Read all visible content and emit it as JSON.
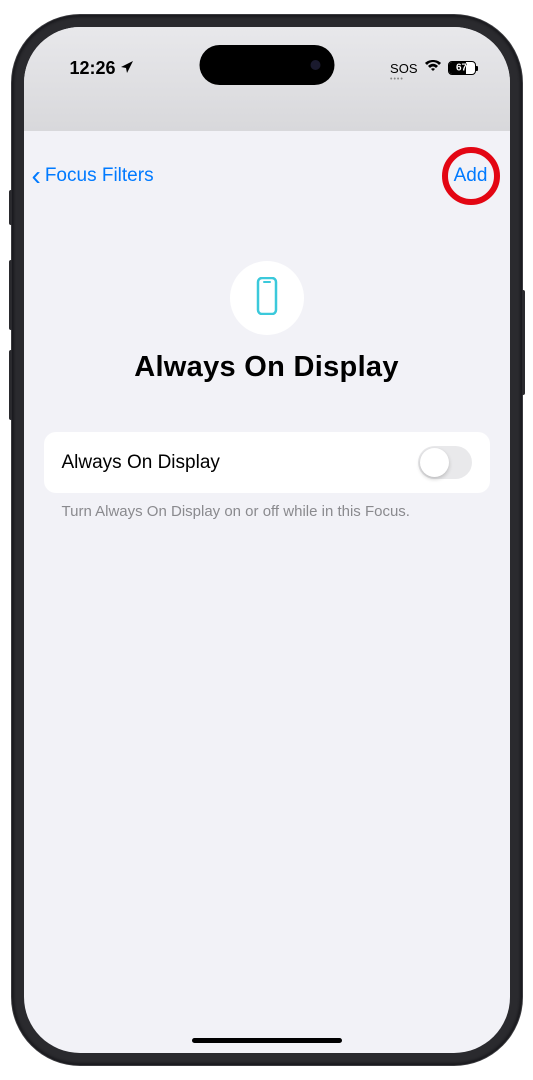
{
  "status": {
    "time": "12:26",
    "sos": "SOS",
    "battery": "67"
  },
  "nav": {
    "back_label": "Focus Filters",
    "add_label": "Add"
  },
  "header": {
    "title": "Always On Display"
  },
  "setting": {
    "label": "Always On Display"
  },
  "description": "Turn Always On Display on or off while in this Focus."
}
